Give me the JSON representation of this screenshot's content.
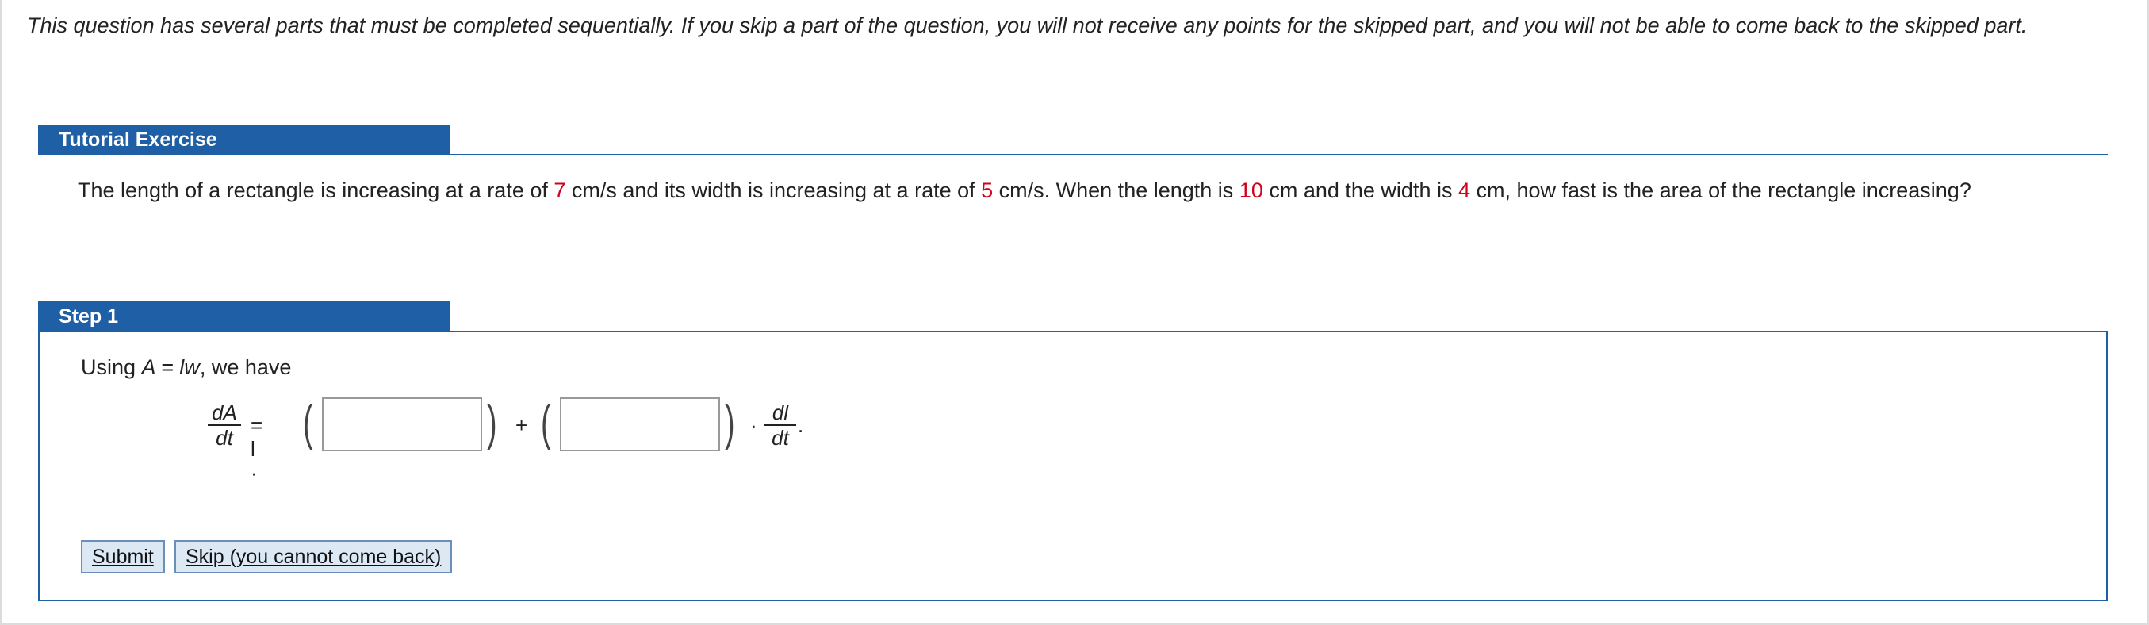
{
  "intro_text": "This question has several parts that must be completed sequentially. If you skip a part of the question, you will not receive any points for the skipped part, and you will not be able to come back to the skipped part.",
  "tutorial": {
    "tab_label": "Tutorial Exercise",
    "problem": {
      "p1": "The length of a rectangle is increasing at a rate of ",
      "rate_length": "7",
      "p2": " cm/s and its width is increasing at a rate of ",
      "rate_width": "5",
      "p3": " cm/s. When the length is ",
      "length": "10",
      "p4": " cm and the width is ",
      "width": "4",
      "p5": " cm, how fast is the area of the rectangle increasing?"
    }
  },
  "step1": {
    "tab_label": "Step 1",
    "using_prefix": "Using ",
    "formula": "A = lw",
    "using_suffix": ", we have",
    "equation": {
      "lhs_num": "dA",
      "lhs_den": "dt",
      "equals_l_dot": "= l ·",
      "plus": "+",
      "dot": "·",
      "rhs_num": "dl",
      "rhs_den": "dt",
      "period": ".",
      "input1_value": "",
      "input2_value": ""
    },
    "buttons": {
      "submit": "Submit",
      "skip": "Skip (you cannot come back)"
    }
  }
}
